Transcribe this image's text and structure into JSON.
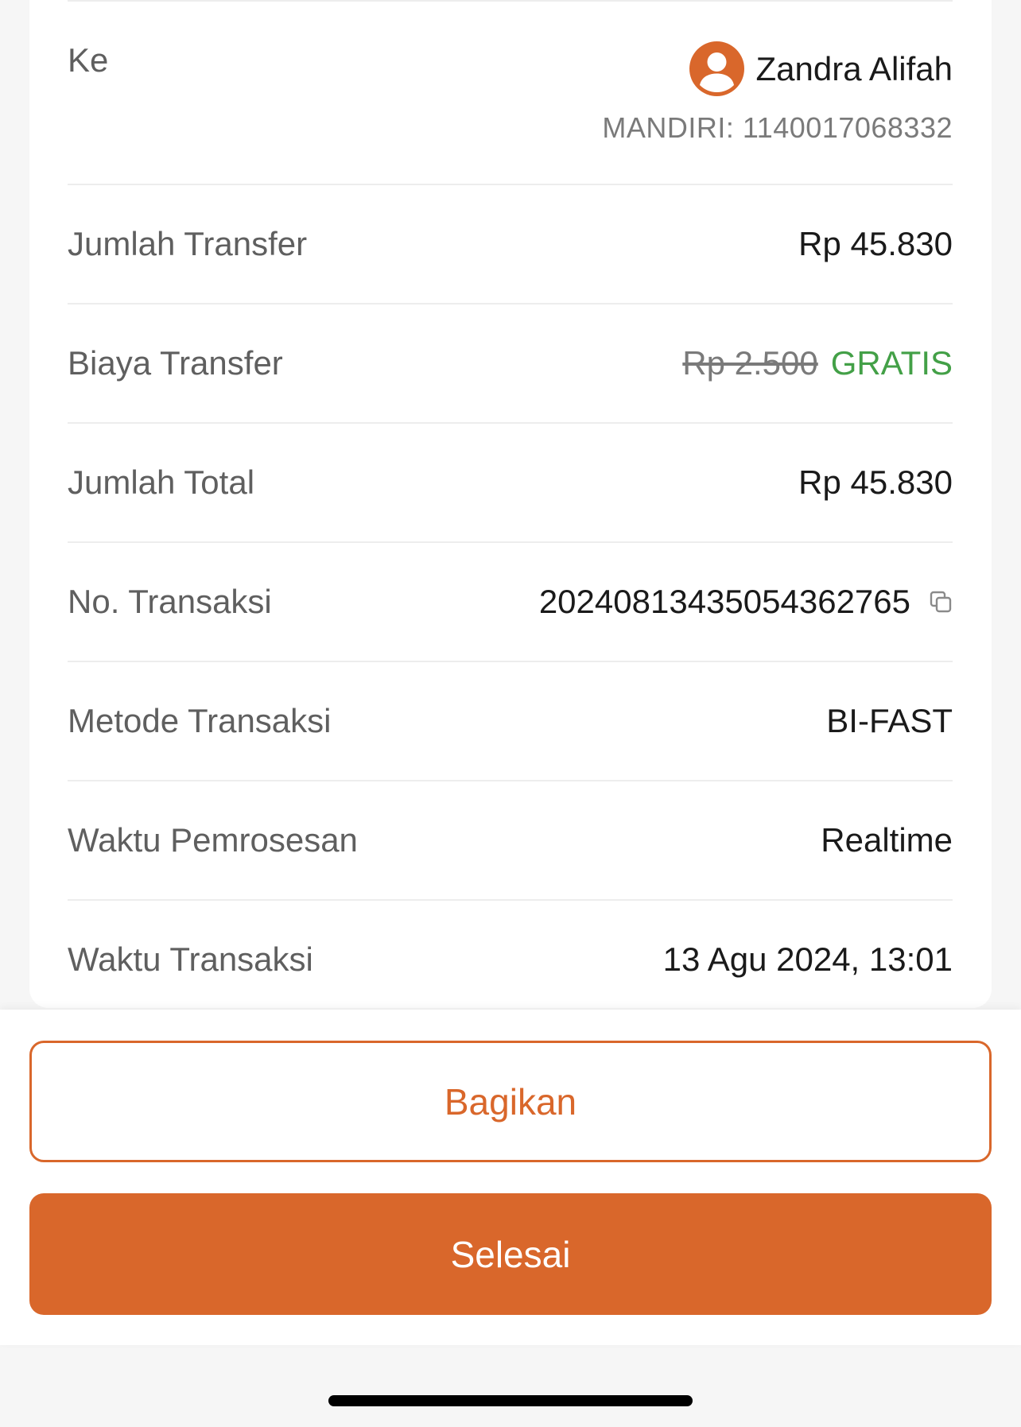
{
  "recipient": {
    "label": "Ke",
    "name": "Zandra Alifah",
    "account": "MANDIRI: 1140017068332",
    "avatar_icon": "user-avatar-icon"
  },
  "details": [
    {
      "label": "Jumlah Transfer",
      "value": "Rp 45.830"
    },
    {
      "label": "Biaya Transfer",
      "original_value": "Rp 2.500",
      "value": "GRATIS"
    },
    {
      "label": "Jumlah Total",
      "value": "Rp 45.830"
    },
    {
      "label": "No. Transaksi",
      "value": "20240813435054362765",
      "icon": "copy-icon"
    },
    {
      "label": "Metode Transaksi",
      "value": "BI-FAST"
    },
    {
      "label": "Waktu Pemrosesan",
      "value": "Realtime"
    },
    {
      "label": "Waktu Transaksi",
      "value": "13 Agu 2024, 13:01"
    }
  ],
  "actions": {
    "share_label": "Bagikan",
    "done_label": "Selesai"
  },
  "colors": {
    "accent": "#D9672B",
    "free": "#43A047",
    "label_text": "#5F5F5F",
    "value_text": "#1A1A1A",
    "muted_text": "#7A7A7A"
  }
}
